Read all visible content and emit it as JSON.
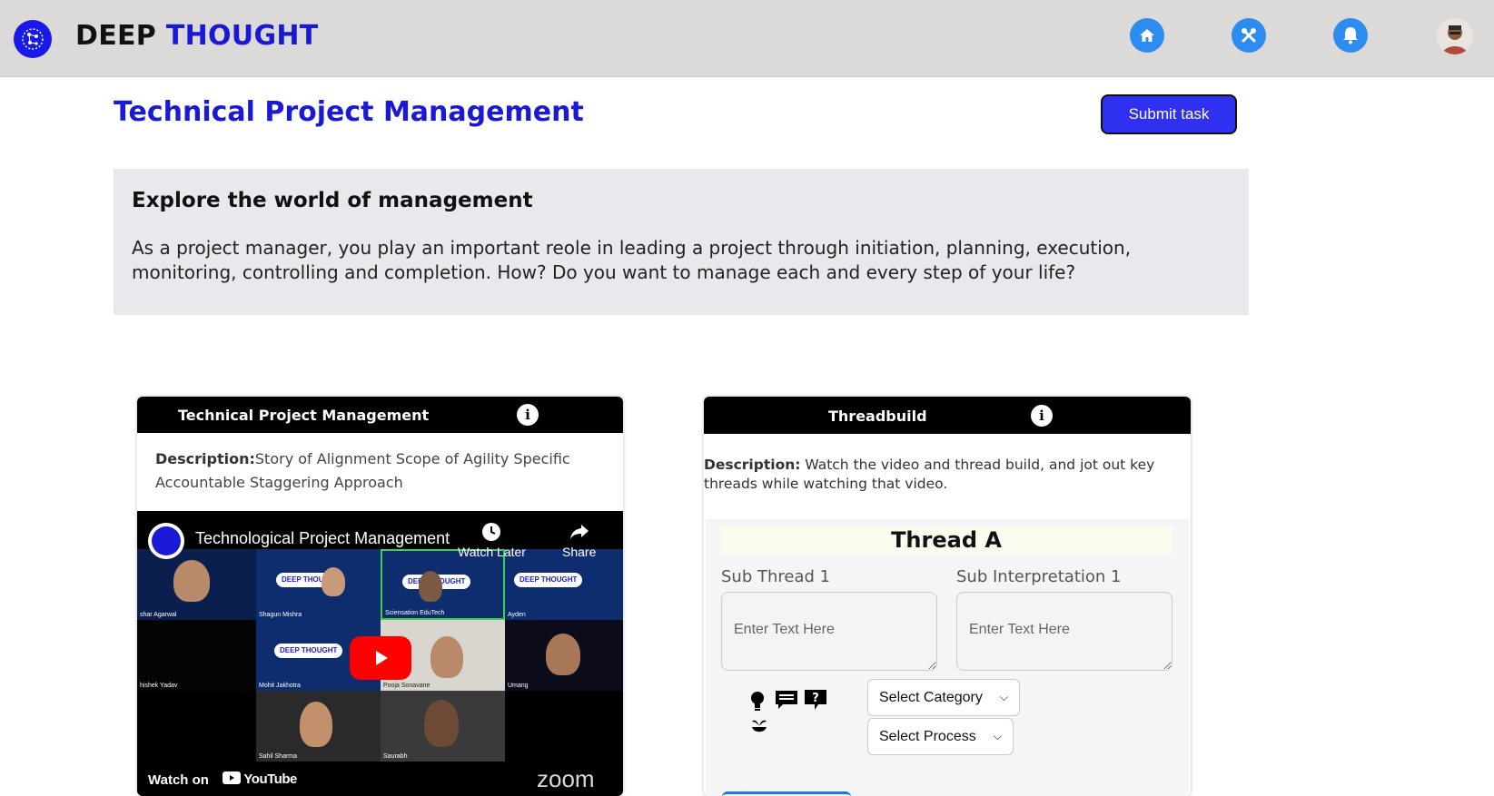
{
  "header": {
    "brand_part1": "DEEP",
    "brand_part2": "THOUGHT",
    "nav_icons": [
      "home-icon",
      "tools-icon",
      "bell-icon"
    ],
    "avatar_icon": "user-avatar"
  },
  "page": {
    "title": "Technical Project Management",
    "submit_label": "Submit task"
  },
  "intro": {
    "heading": "Explore the world of management",
    "body": "As a project manager, you play an important reole in leading a project through initiation, planning, execution, monitoring, controlling and completion. How? Do you want to manage each and every step of your life?"
  },
  "video_card": {
    "title": "Technical Project Management",
    "desc_label": "Description:",
    "desc_text": "Story of Alignment Scope of Agility Specific Accountable Staggering Approach",
    "video": {
      "title": "Technological Project Management",
      "watch_later": "Watch Later",
      "share": "Share",
      "watch_on": "Watch on",
      "youtube": "YouTube",
      "zoom": "zoom",
      "participants": [
        "shar Agarwal",
        "Shagun Mishra",
        "Sciensation EduTech",
        "Ayden",
        "hishek Yadav",
        "Mohit Jakhotra",
        "Pooja Sonavane",
        "Umang",
        "Sahil Sharma",
        "Saurabh"
      ],
      "chip_text": "DEEP THOUGHT"
    }
  },
  "thread_card": {
    "title": "Threadbuild",
    "desc_label": "Description:",
    "desc_text": " Watch the video and thread build, and jot out key threads while watching that video.",
    "thread_title": "Thread A",
    "sub_thread_label": "Sub Thread 1",
    "sub_interp_label": "Sub Interpretation 1",
    "placeholder": "Enter Text Here",
    "category_select": "Select Category",
    "process_select": "Select Process",
    "tool_icons": [
      "bulb-icon",
      "comment-icon",
      "question-icon",
      "sprout-icon"
    ]
  },
  "colors": {
    "brand_blue": "#1a1ad6",
    "button_blue": "#3030f0",
    "nav_icon_blue": "#2d8cf0",
    "header_bg": "#dcd9d9",
    "intro_bg": "#e7e9ec"
  }
}
